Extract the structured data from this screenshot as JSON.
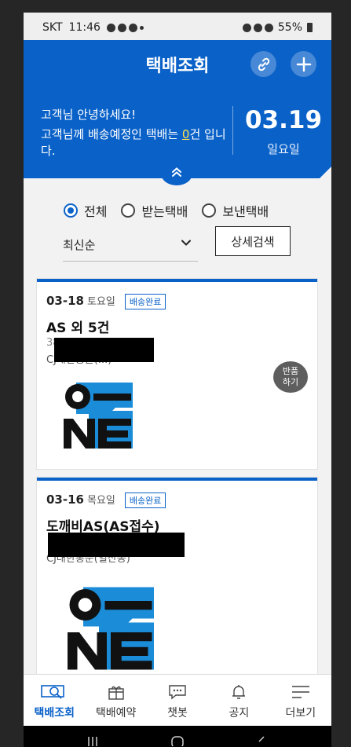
{
  "status_bar": {
    "carrier": "SKT",
    "time": "11:46",
    "battery": "55%"
  },
  "header": {
    "title": "택배조회"
  },
  "banner": {
    "greeting": "고객님 안녕하세요!",
    "message_prefix": "고객님께 배송예정인 택배는 ",
    "count": "0",
    "message_suffix": "건 입니다.",
    "date": "03.19",
    "weekday": "일요일"
  },
  "filters": {
    "radios": [
      "전체",
      "받는택배",
      "보낸택배"
    ],
    "selected": "전체",
    "sort": "최신순",
    "detail_search": "상세검색"
  },
  "deliveries": [
    {
      "date": "03-18",
      "weekday": "토요일",
      "status": "배송완료",
      "name": "AS 외 5건",
      "tracking_visible": "38",
      "courier_visible": "CJ대한통운(...)",
      "return_label": "반품 하기"
    },
    {
      "date": "03-16",
      "weekday": "목요일",
      "status": "배송완료",
      "name": "도깨비AS(AS접수)",
      "tracking_visible": "",
      "courier_visible": "CJ대한통운(일산동)"
    }
  ],
  "bottom_nav": [
    {
      "label": "택배조회",
      "icon": "search-box-icon"
    },
    {
      "label": "택배예약",
      "icon": "gift-box-icon"
    },
    {
      "label": "챗봇",
      "icon": "chat-icon"
    },
    {
      "label": "공지",
      "icon": "bell-icon"
    },
    {
      "label": "더보기",
      "icon": "menu-icon"
    }
  ],
  "colors": {
    "primary": "#0a62c9",
    "highlight": "#ffe14d",
    "logo_blue": "#1a8cd8"
  }
}
